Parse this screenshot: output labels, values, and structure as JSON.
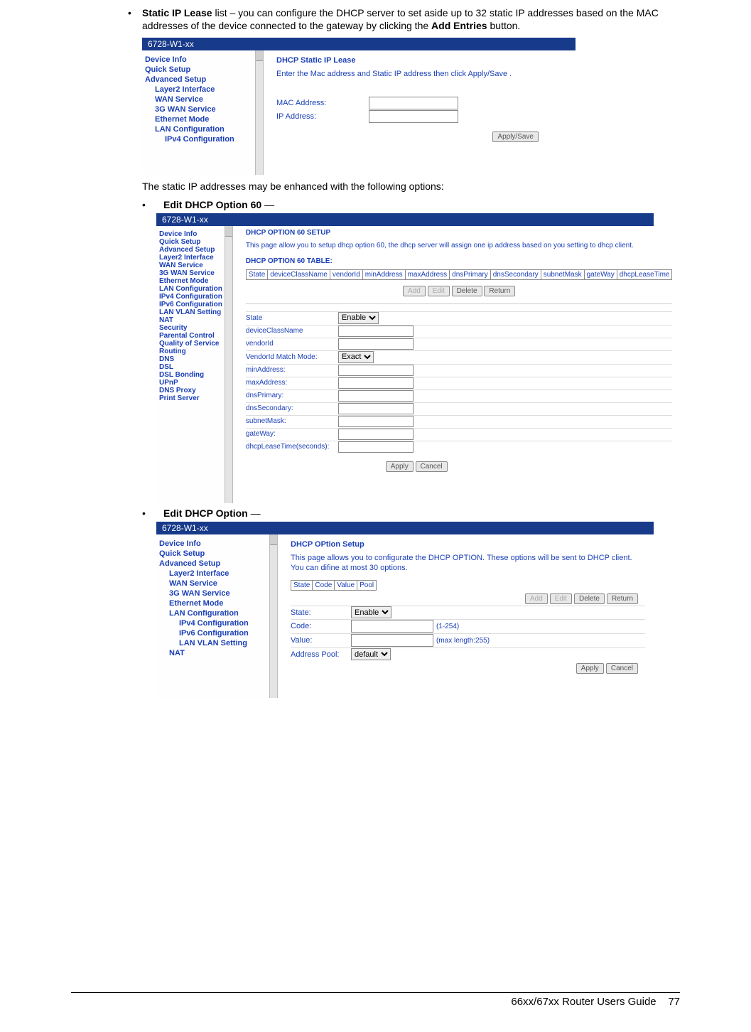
{
  "doc": {
    "bullet1_lead": "Static IP Lease",
    "bullet1_rest": " list – you can configure the DHCP server to set aside up to 32 static IP addresses based on the MAC addresses of the device connected to the gateway by clicking the ",
    "bullet1_btn": "Add Entries",
    "bullet1_tail": " button.",
    "para2": "The static IP addresses may be enhanced with the following options:",
    "bullet2_lead": "Edit DHCP Option 60",
    "bullet2_tail": " —",
    "bullet3_lead": "Edit DHCP Option",
    "bullet3_tail": " —",
    "footer_title": "66xx/67xx Router Users Guide",
    "footer_page": "77"
  },
  "shot1": {
    "title": "6728-W1-xx",
    "nav": [
      "Device Info",
      "Quick Setup",
      "Advanced Setup"
    ],
    "nav_sub": [
      "Layer2 Interface",
      "WAN Service",
      "3G WAN Service",
      "Ethernet Mode",
      "LAN Configuration"
    ],
    "nav_sub2": [
      "IPv4 Configuration"
    ],
    "heading": "DHCP Static IP Lease",
    "desc": "Enter the Mac address and Static IP address then click Apply/Save .",
    "row1": "MAC Address:",
    "row2": "IP Address:",
    "btn": "Apply/Save"
  },
  "shot2": {
    "title": "6728-W1-xx",
    "nav": [
      "Device Info",
      "Quick Setup",
      "Advanced Setup"
    ],
    "nav_sub": [
      "Layer2 Interface",
      "WAN Service",
      "3G WAN Service",
      "Ethernet Mode",
      "LAN Configuration"
    ],
    "nav_sub2": [
      "IPv4 Configuration",
      "IPv6 Configuration",
      "LAN VLAN Setting"
    ],
    "nav_tail": [
      "NAT",
      "Security",
      "Parental Control",
      "Quality of Service",
      "Routing",
      "DNS",
      "DSL",
      "DSL Bonding",
      "UPnP",
      "DNS Proxy",
      "Print Server"
    ],
    "heading": "DHCP OPTION 60 SETUP",
    "desc": "This page allow you to setup dhcp option 60, the dhcp server will assign one ip address based on you setting to dhcp client.",
    "tablehead": "DHCP OPTION 60 TABLE:",
    "cols": [
      "State",
      "deviceClassName",
      "vendorId",
      "minAddress",
      "maxAddress",
      "dnsPrimary",
      "dnsSecondary",
      "subnetMask",
      "gateWay",
      "dhcpLeaseTime"
    ],
    "btns_mid": [
      "Add",
      "Edit",
      "Delete",
      "Return"
    ],
    "formrows": [
      {
        "lbl": "State",
        "type": "select",
        "val": "Enable"
      },
      {
        "lbl": "deviceClassName",
        "type": "text"
      },
      {
        "lbl": "vendorId",
        "type": "text"
      },
      {
        "lbl": "VendorId Match Mode:",
        "type": "select",
        "val": "Exact"
      },
      {
        "lbl": "minAddress:",
        "type": "text"
      },
      {
        "lbl": "maxAddress:",
        "type": "text"
      },
      {
        "lbl": "dnsPrimary:",
        "type": "text"
      },
      {
        "lbl": "dnsSecondary:",
        "type": "text"
      },
      {
        "lbl": "subnetMask:",
        "type": "text"
      },
      {
        "lbl": "gateWay:",
        "type": "text"
      },
      {
        "lbl": "dhcpLeaseTime(seconds):",
        "type": "text"
      }
    ],
    "btns_bot": [
      "Apply",
      "Cancel"
    ]
  },
  "shot3": {
    "title": "6728-W1-xx",
    "nav": [
      "Device Info",
      "Quick Setup",
      "Advanced Setup"
    ],
    "nav_sub": [
      "Layer2 Interface",
      "WAN Service",
      "3G WAN Service",
      "Ethernet Mode",
      "LAN Configuration"
    ],
    "nav_sub2": [
      "IPv4 Configuration",
      "IPv6 Configuration",
      "LAN VLAN Setting"
    ],
    "nav_tail": [
      "NAT"
    ],
    "heading": "DHCP OPtion Setup",
    "desc": "This page allows you to configurate the DHCP OPTION. These options will be sent to DHCP client. You can difine at most 30 options.",
    "cols": [
      "State",
      "Code",
      "Value",
      "Pool"
    ],
    "btns_mid": [
      "Add",
      "Edit",
      "Delete",
      "Return"
    ],
    "formrows": [
      {
        "lbl": "State:",
        "type": "select",
        "val": "Enable",
        "hint": ""
      },
      {
        "lbl": "Code:",
        "type": "text",
        "hint": "(1-254)"
      },
      {
        "lbl": "Value:",
        "type": "text",
        "hint": "(max length:255)"
      },
      {
        "lbl": "Address Pool:",
        "type": "select",
        "val": "default",
        "hint": ""
      }
    ],
    "btns_bot": [
      "Apply",
      "Cancel"
    ]
  }
}
